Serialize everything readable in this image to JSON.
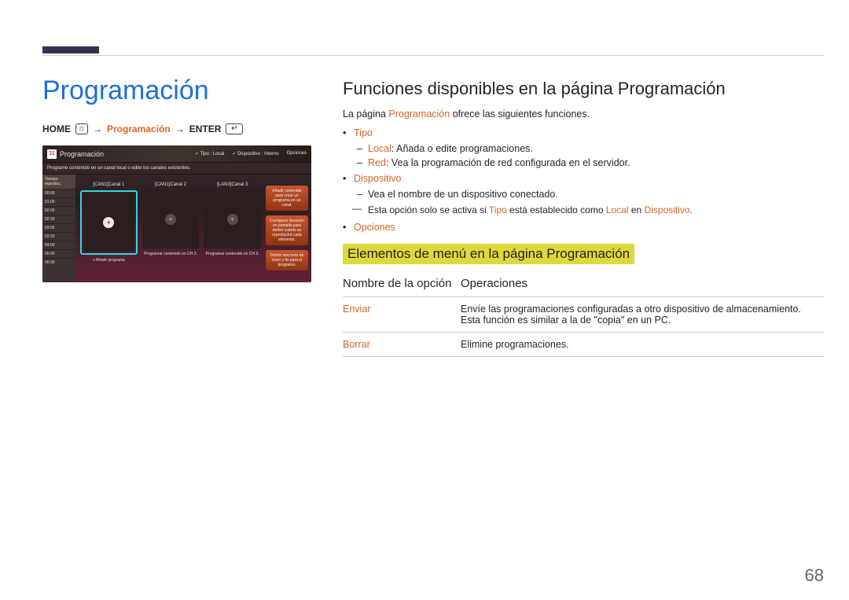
{
  "page_number": "68",
  "left": {
    "title": "Programación",
    "breadcrumb": {
      "home": "HOME",
      "mid": "Programación",
      "enter": "ENTER",
      "arrow": "→"
    },
    "screenshot": {
      "cal_day": "31",
      "title": "Programación",
      "top_right": {
        "tipo": "Tipo : Local",
        "dispositivo": "Dispositivo : Interno",
        "opciones": "Opciones"
      },
      "subtitle": "Programe contenido en un canal local o edite los canales existentes.",
      "times_header": "Tiempo reproduc.",
      "times": [
        "00:00",
        "01:00",
        "02:00",
        "02:30",
        "03:00",
        "03:30",
        "04:00",
        "05:00",
        "06:00"
      ],
      "channels": [
        {
          "name": "[CAN1]Canal 1",
          "caption": "+ Añadir programa",
          "selected": true
        },
        {
          "name": "[CAN1]Canal 2",
          "caption": "Programar contenido en CH 2."
        },
        {
          "name": "[LAN3]Canal 3",
          "caption": "Programar contenido en CH 3."
        }
      ],
      "right_tiles": [
        "Añadir contenido para crear un programa en un canal.",
        "Configurar duración en pantalla para definir cuánto se reproducirá cada elemento.",
        "Definir una hora de inicio y fin para el programa."
      ]
    }
  },
  "right": {
    "h2": "Funciones disponibles en la página Programación",
    "intro_a": "La página ",
    "intro_b": "Programación",
    "intro_c": " ofrece las siguientes funciones.",
    "tipo": "Tipo",
    "tipo_local_k": "Local",
    "tipo_local_v": ": Añada o edite programaciones.",
    "tipo_red_k": "Red",
    "tipo_red_v": ": Vea la programación de red configurada en el servidor.",
    "dispositivo": "Dispositivo",
    "dispositivo_v": "Vea el nombre de un dispositivo conectado.",
    "foot_a": "Esta opción solo se activa si ",
    "foot_b": "Tipo",
    "foot_c": " está establecido como ",
    "foot_d": "Local",
    "foot_e": " en ",
    "foot_f": "Dispositivo",
    "foot_g": ".",
    "opciones": "Opciones",
    "h3": "Elementos de menú en la página Programación",
    "table": {
      "th1": "Nombre de la opción",
      "th2": "Operaciones",
      "rows": [
        {
          "name": "Enviar",
          "desc1": "Envíe las programaciones configuradas a otro dispositivo de almacenamiento.",
          "desc2": "Esta función es similar a la de \"copia\" en un PC."
        },
        {
          "name": "Borrar",
          "desc1": "Elimine programaciones.",
          "desc2": ""
        }
      ]
    }
  }
}
